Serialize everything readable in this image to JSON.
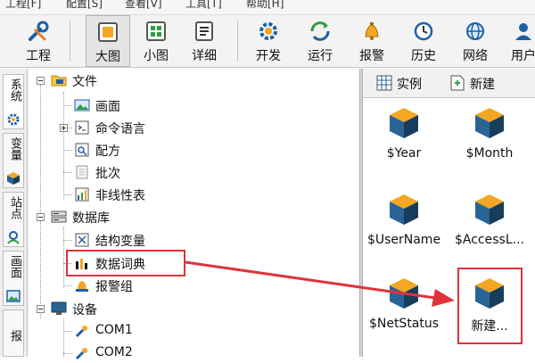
{
  "menu": [
    "工程[F]",
    "配置[S]",
    "查看[V]",
    "工具[T]",
    "帮助[H]"
  ],
  "toolbar": {
    "project": "工程",
    "large_icon": "大图",
    "small_icon": "小图",
    "detail": "详细",
    "develop": "开发",
    "run": "运行",
    "alarm": "报警",
    "history": "历史",
    "network": "网络",
    "user": "用户"
  },
  "side_tabs": {
    "system": "系统",
    "variable": "变量",
    "station": "站点",
    "screen": "画面",
    "report": "报"
  },
  "tree": {
    "file": "文件",
    "screen": "画面",
    "command_language": "命令语言",
    "recipe": "配方",
    "batch": "批次",
    "nonlinear_table": "非线性表",
    "database": "数据库",
    "struct_variable": "结构变量",
    "data_dictionary": "数据词典",
    "alarm_group": "报警组",
    "device": "设备",
    "com1": "COM1",
    "com2": "COM2"
  },
  "right_toolbar": {
    "instance": "实例",
    "new": "新建"
  },
  "variables": [
    "$Year",
    "$Month",
    "$UserName",
    "$AccessL...",
    "$NetStatus",
    "新建..."
  ],
  "colors": {
    "highlight": "#e0323c",
    "cube_top": "#f5a623",
    "cube_side": "#1b4f78"
  }
}
